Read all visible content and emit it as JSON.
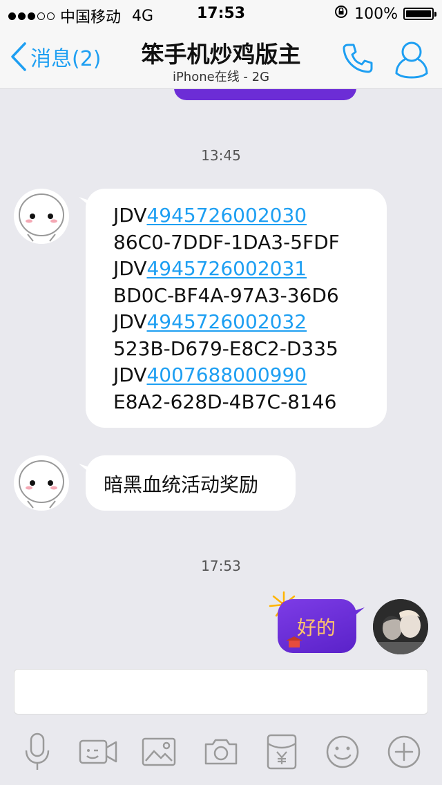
{
  "status_bar": {
    "carrier": "中国移动",
    "network": "4G",
    "time": "17:53",
    "battery": "100%",
    "battery_level": 1.0
  },
  "nav": {
    "back_label": "消息(2)",
    "title": "笨手机炒鸡版主",
    "subtitle": "iPhone在线 - 2G"
  },
  "messages": {
    "time_1": "13:45",
    "codes": [
      {
        "prefix": "JDV",
        "number": "4945726002030"
      },
      {
        "text": "86C0-7DDF-1DA3-5FDF"
      },
      {
        "prefix": "JDV",
        "number": "4945726002031"
      },
      {
        "text": "BD0C-BF4A-97A3-36D6"
      },
      {
        "prefix": "JDV",
        "number": "4945726002032"
      },
      {
        "text": "523B-D679-E8C2-D335"
      },
      {
        "prefix": "JDV",
        "number": "4007688000990"
      },
      {
        "text": "E8A2-628D-4B7C-8146"
      }
    ],
    "text_2": "暗黑血统活动奖励",
    "time_2": "17:53",
    "reply": "好的"
  },
  "input": {
    "placeholder": "",
    "value": ""
  },
  "colors": {
    "accent": "#1e9ff2",
    "bubble_purple": "#6c2dd6",
    "reply_text": "#ffc46b"
  },
  "toolbar_icons": [
    "microphone-icon",
    "video-icon",
    "image-icon",
    "camera-icon",
    "red-packet-icon",
    "emoji-icon",
    "plus-icon"
  ]
}
